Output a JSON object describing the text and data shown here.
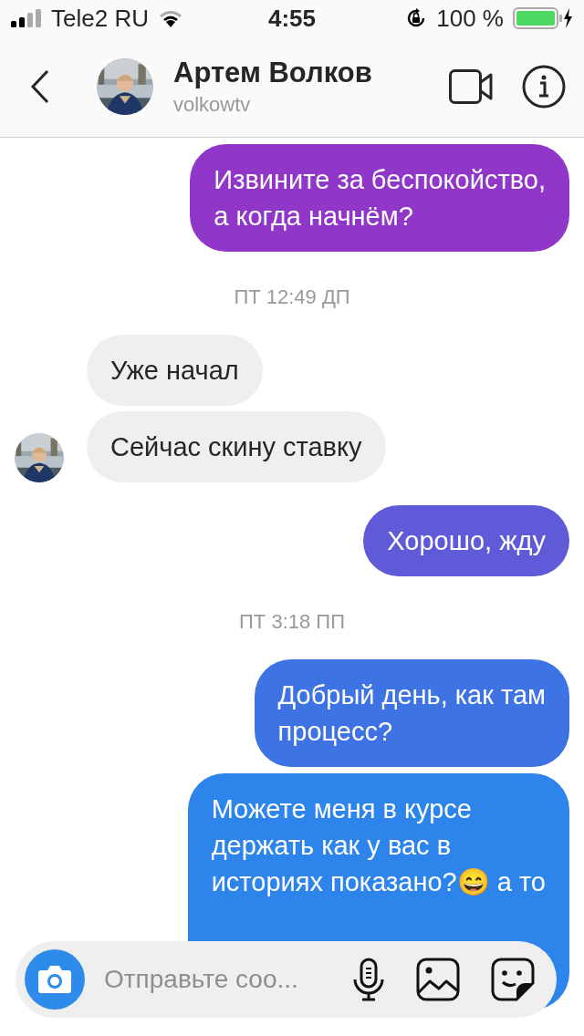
{
  "status_bar": {
    "carrier": "Tele2 RU",
    "time": "4:55",
    "battery": "100 %"
  },
  "header": {
    "name": "Артем Волков",
    "username": "volkowtv"
  },
  "messages": [
    {
      "kind": "outgoing",
      "text": "Извините за беспокойство,\nа когда начнём?",
      "color": "#9036c8"
    },
    {
      "kind": "timestamp",
      "text": "ПТ 12:49 ДП"
    },
    {
      "kind": "incoming",
      "text": "Уже начал",
      "show_avatar": false
    },
    {
      "kind": "incoming",
      "text": "Сейчас скину ставку",
      "show_avatar": true
    },
    {
      "kind": "outgoing",
      "text": "Хорошо, жду",
      "color": "#5f5ad8"
    },
    {
      "kind": "timestamp",
      "text": "ПТ 3:18 ПП"
    },
    {
      "kind": "outgoing",
      "text": "Добрый день, как там\nпроцесс?",
      "color": "#3d73e2"
    },
    {
      "kind": "outgoing",
      "text": "Можете меня в курсе\nдержать как у вас в\nисториях показано?😄 а то",
      "color": "#2d84ea"
    }
  ],
  "composer": {
    "placeholder": "Отправьте соо..."
  }
}
